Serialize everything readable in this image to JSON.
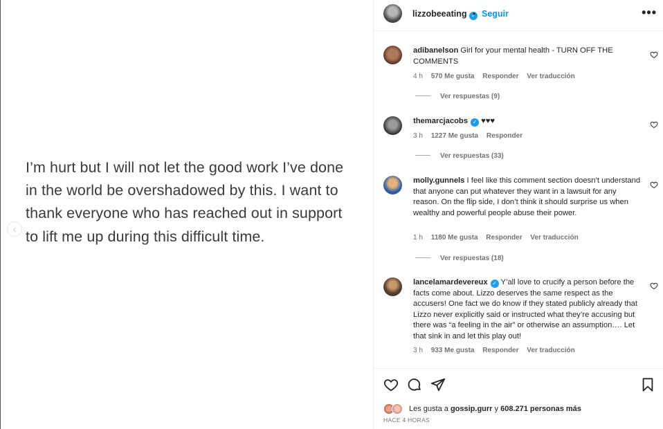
{
  "post": {
    "text": "I’m hurt but I will not let the good work I’ve done in the world be overshadowed by this. I want to thank everyone who has reached out in support to lift me up during this difficult time.",
    "prev_glyph": "‹"
  },
  "header": {
    "username": "lizzobeeating",
    "verified_glyph": "✓",
    "separator": "•",
    "follow_label": "Seguir",
    "more_glyph": "•••"
  },
  "comments": [
    {
      "username": "adibanelson",
      "verified": false,
      "text": "Girl for your mental health - TURN OFF THE COMMENTS",
      "time": "4 h",
      "likes": "570 Me gusta",
      "reply_label": "Responder",
      "translate_label": "Ver traducción",
      "replies_label": "Ver respuestas (9)",
      "avatar_color": "#7a4b34"
    },
    {
      "username": "themarcjacobs",
      "verified": true,
      "text": "♥♥♥",
      "time": "3 h",
      "likes": "1227 Me gusta",
      "reply_label": "Responder",
      "translate_label": "",
      "replies_label": "Ver respuestas (33)",
      "avatar_color": "#3a3a3a"
    },
    {
      "username": "molly.gunnels",
      "verified": false,
      "text": "I feel like this comment section doesn’t understand that anyone can put whatever they want in a lawsuit for any reason. On the flip side, I don’t think it should surprise us when wealthy and powerful people abuse their power.",
      "time": "1 h",
      "likes": "1180 Me gusta",
      "reply_label": "Responder",
      "translate_label": "Ver traducción",
      "replies_label": "Ver respuestas (18)",
      "avatar_color": "#2f5fa8"
    },
    {
      "username": "lancelamardevereux",
      "verified": true,
      "text": "Y’all love to crucify a person before the facts come about. Lizzo deserves the same respect as the accusers! One fact we do know if they stated publicly already that Lizzo never explicitly said or instructed what they’re accusing but there was “a feeling in the air” or otherwise an assumption…. Let that sink in and let this play out!",
      "time": "3 h",
      "likes": "933 Me gusta",
      "reply_label": "Responder",
      "translate_label": "Ver traducción",
      "replies_label": "",
      "avatar_color": "#5a4530"
    }
  ],
  "actions": {
    "likes_prefix": "Les gusta a",
    "likes_user": "gossip.gurr",
    "likes_middle": "y",
    "likes_count": "608.271 personas más",
    "time_ago": "HACE 4 HORAS"
  },
  "colors": {
    "accent": "#0095f6",
    "verified": "#1d9bf0",
    "meta": "#737373"
  }
}
